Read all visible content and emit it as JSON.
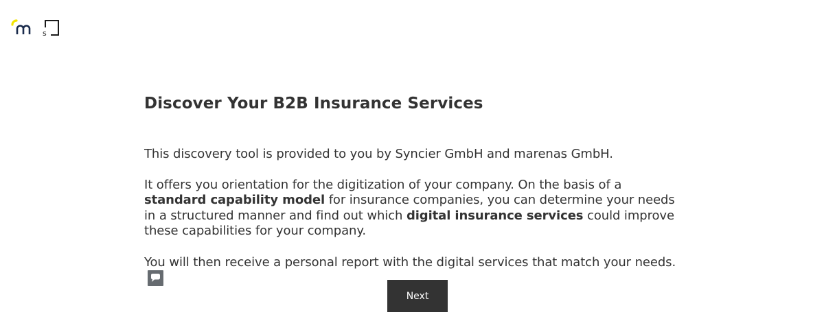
{
  "header": {
    "logos": [
      "marenas-logo-icon",
      "syncier-logo-icon"
    ]
  },
  "main": {
    "title": "Discover Your B2B Insurance Services",
    "intro": "This discovery tool is provided to you by Syncier GmbH and marenas GmbH.",
    "description": {
      "part1": "It offers you orientation for the digitization of your company. On the basis of a ",
      "bold1": "standard capability model",
      "part2": " for insurance companies, you can determine your needs in a structured manner and find out which ",
      "bold2": "digital insurance services",
      "part3": " could improve these capabilities for your company."
    },
    "report_text": "You will then receive a personal report with the digital services that match your needs.",
    "report_icon": "chat-bubble-icon",
    "next_label": "Next"
  },
  "colors": {
    "text": "#333333",
    "button_bg": "#333333",
    "button_text": "#ffffff",
    "logo_accent": "#f2e400",
    "logo_dark": "#1a2b4c",
    "icon_bg": "#666b70"
  }
}
